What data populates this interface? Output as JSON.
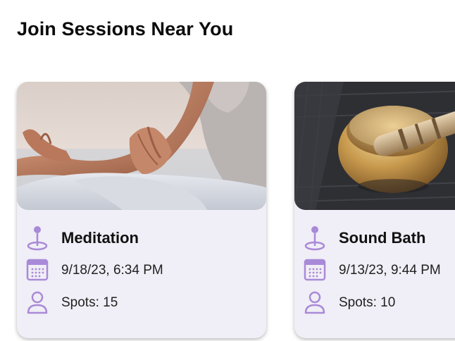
{
  "section": {
    "title": "Join Sessions Near You"
  },
  "sessions": [
    {
      "title": "Meditation",
      "date": "9/18/23, 6:34 PM",
      "spots": "Spots: 15",
      "image": "meditation-photo",
      "icons": [
        "location-pin-icon",
        "calendar-icon",
        "person-icon"
      ]
    },
    {
      "title": "Sound Bath",
      "date": "9/13/23, 9:44 PM",
      "spots": "Spots: 10",
      "image": "singing-bowl-photo",
      "icons": [
        "location-pin-icon",
        "calendar-icon",
        "person-icon"
      ]
    }
  ],
  "colors": {
    "accent": "#a98ad8",
    "card_bg": "#f0eef6"
  }
}
